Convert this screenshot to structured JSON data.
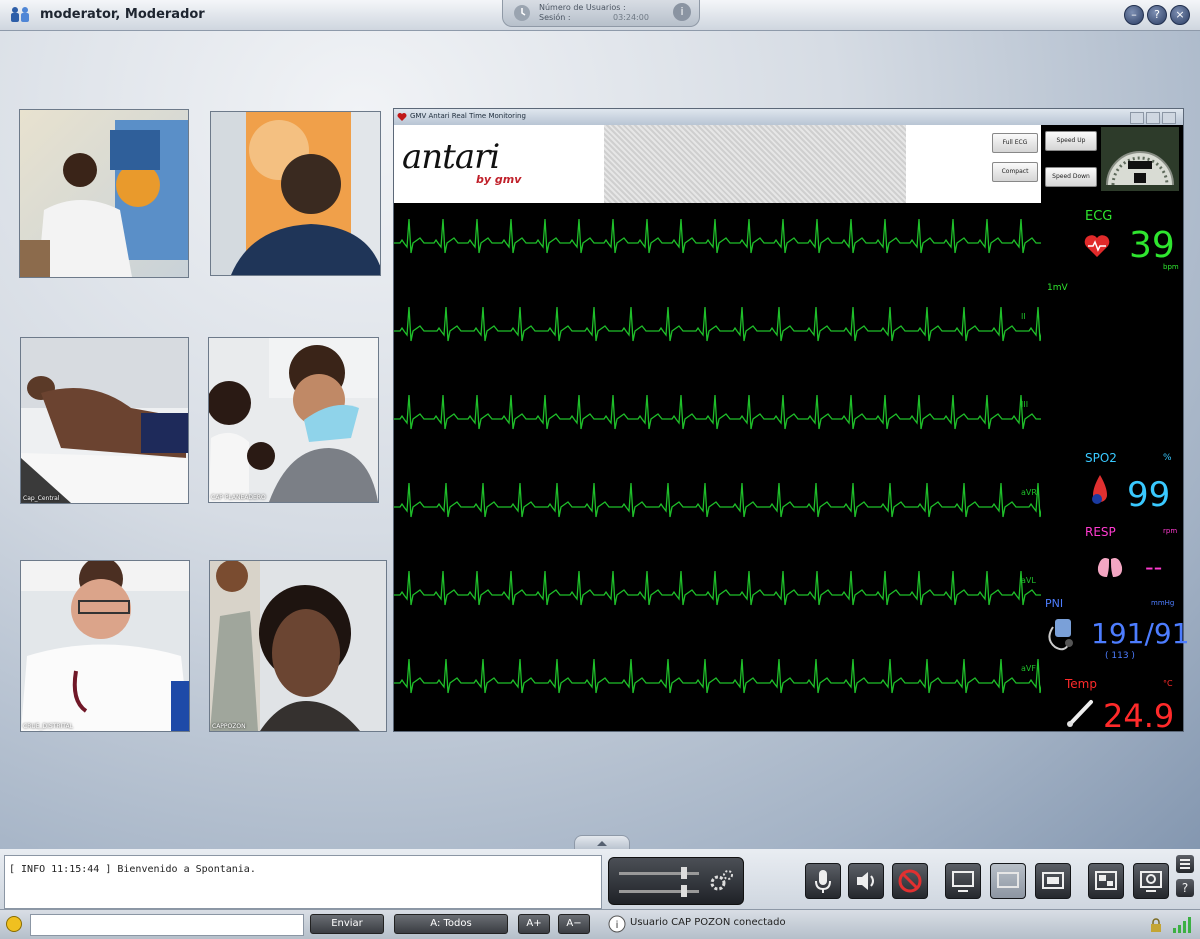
{
  "window": {
    "title": "moderator, Moderador",
    "session_label_1": "Número de Usuarios :",
    "session_label_2": "Sesión :",
    "session_value": "03:24:00"
  },
  "videos": [
    {
      "name": "video-doctor-1",
      "caption": ""
    },
    {
      "name": "video-young-man",
      "caption": ""
    },
    {
      "name": "video-patient",
      "caption": "Cap_Central"
    },
    {
      "name": "video-group",
      "caption": "CAP PLANEADERO"
    },
    {
      "name": "video-doctor-2",
      "caption": "CRUE_DISTRITAL"
    },
    {
      "name": "video-woman",
      "caption": "CAPPOZON"
    }
  ],
  "monitor": {
    "title": "GMV Antari Real Time Monitoring",
    "logo": "antari",
    "logo_by": "by gmv",
    "btn_full_ecg": "Full ECG",
    "btn_compact": "Compact",
    "btn_speed_up": "Speed Up",
    "btn_speed_down": "Speed Down",
    "leads": [
      "",
      "II",
      "III",
      "aVR",
      "aVL",
      "aVF"
    ],
    "ecg": {
      "label": "ECG",
      "value": "39",
      "unit": "bpm",
      "sub": "1mV",
      "color": "#2fe52f"
    },
    "spo2": {
      "label": "SPO2",
      "value": "99",
      "unit": "%",
      "color": "#39c9ff"
    },
    "resp": {
      "label": "RESP",
      "value": "--",
      "unit": "rpm",
      "color": "#ff3bd0"
    },
    "nibp": {
      "label": "PNI",
      "value": "191/91",
      "unit": "mmHg",
      "sub": "( 113 )",
      "color": "#4d7dff"
    },
    "temp": {
      "label": "Temp",
      "value": "24.9",
      "unit": "°C",
      "color": "#ff2a2a"
    }
  },
  "log": {
    "line": "[ INFO 11:15:44 ] Bienvenido a Spontania."
  },
  "statusbar": {
    "send": "Enviar",
    "to_all": "A: Todos",
    "font_up": "A+",
    "font_down": "A−",
    "message": "Usuario CAP POZON conectado"
  }
}
